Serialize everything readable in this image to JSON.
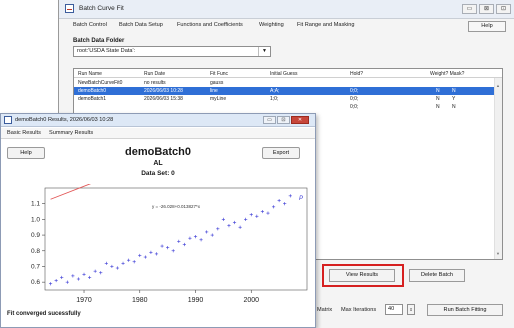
{
  "main_window": {
    "title": "Batch Curve Fit",
    "controls": [
      "▭",
      "⊠",
      "⊡"
    ],
    "tabs": [
      "Batch Control",
      "Batch Data Setup",
      "Functions and Coefficients",
      "Weighting",
      "Fit Range and Masking"
    ],
    "help_label": "Help",
    "folder_label": "Batch Data Folder",
    "folder_value": "root:'USDA State Data':",
    "folder_arrow": "▼"
  },
  "batch_table": {
    "headers": [
      "Run Name",
      "Run Date",
      "Fit Func",
      "Initial Guess",
      "Hold?",
      "Weight? Mask?"
    ],
    "rows": [
      {
        "run_name": "NewBatchCurveFit0",
        "run_date": "no results",
        "fit_func": "gauss",
        "initial_guess": "",
        "hold": "",
        "weight": "",
        "mask": "",
        "selected": false
      },
      {
        "run_name": "demoBatch0",
        "run_date": "2026/06/03 10:28",
        "fit_func": "line",
        "initial_guess": "A;A;",
        "hold": "0;0;",
        "weight": "N",
        "mask": "N",
        "selected": true
      },
      {
        "run_name": "demoBatch1",
        "run_date": "2026/06/03 15:38",
        "fit_func": "myLine",
        "initial_guess": "1;0;",
        "hold": "0;0;",
        "weight": "N",
        "mask": "Y",
        "selected": false
      },
      {
        "run_name": "",
        "run_date": "",
        "fit_func": "",
        "initial_guess": "",
        "hold": "0;0;",
        "weight": "N",
        "mask": "N",
        "selected": false
      }
    ]
  },
  "buttons": {
    "view_results": "View Results",
    "delete_batch": "Delete Batch",
    "run_batch_fitting": "Run Batch Fitting"
  },
  "bottom": {
    "matrix_label": "Matrix",
    "max_iterations_label": "Max Iterations",
    "max_iterations_value": "40",
    "spin_glyph": "⇕"
  },
  "results_window": {
    "title": "demoBatch0 Results, 2026/06/03 10:28",
    "controls": [
      "▭",
      "⊡",
      "✕"
    ],
    "tabs": [
      "Basic Results",
      "Summary Results"
    ],
    "help_label": "Help",
    "export_label": "Export",
    "batch_name": "demoBatch0",
    "state": "AL",
    "data_set": "Data Set: 0",
    "status": "Fit converged sucessfully"
  },
  "chart_data": {
    "type": "scatter",
    "title": "",
    "annotation": "y = -26.028+0.013827*x",
    "legend_marker": "P",
    "xlim": [
      1963,
      2010
    ],
    "ylim": [
      0.55,
      1.2
    ],
    "x_ticks": [
      1970,
      1980,
      1990,
      2000
    ],
    "y_ticks": [
      0.6,
      0.7,
      0.8,
      0.9,
      1.0,
      1.1
    ],
    "fit_line": {
      "slope": 0.013827,
      "intercept": -26.028,
      "color": "#e25555"
    },
    "point_color": "#3b3bd6",
    "points": [
      [
        1964,
        0.59
      ],
      [
        1965,
        0.61
      ],
      [
        1966,
        0.63
      ],
      [
        1967,
        0.6
      ],
      [
        1968,
        0.64
      ],
      [
        1969,
        0.62
      ],
      [
        1970,
        0.65
      ],
      [
        1971,
        0.63
      ],
      [
        1972,
        0.67
      ],
      [
        1973,
        0.66
      ],
      [
        1974,
        0.72
      ],
      [
        1975,
        0.7
      ],
      [
        1976,
        0.69
      ],
      [
        1977,
        0.72
      ],
      [
        1978,
        0.74
      ],
      [
        1979,
        0.73
      ],
      [
        1980,
        0.77
      ],
      [
        1981,
        0.76
      ],
      [
        1982,
        0.79
      ],
      [
        1983,
        0.78
      ],
      [
        1984,
        0.83
      ],
      [
        1985,
        0.82
      ],
      [
        1986,
        0.8
      ],
      [
        1987,
        0.86
      ],
      [
        1988,
        0.84
      ],
      [
        1989,
        0.88
      ],
      [
        1990,
        0.89
      ],
      [
        1991,
        0.87
      ],
      [
        1992,
        0.92
      ],
      [
        1993,
        0.9
      ],
      [
        1994,
        0.94
      ],
      [
        1995,
        1.0
      ],
      [
        1996,
        0.96
      ],
      [
        1997,
        0.98
      ],
      [
        1998,
        0.95
      ],
      [
        1999,
        1.0
      ],
      [
        2000,
        1.03
      ],
      [
        2001,
        1.02
      ],
      [
        2002,
        1.05
      ],
      [
        2003,
        1.04
      ],
      [
        2004,
        1.08
      ],
      [
        2005,
        1.12
      ],
      [
        2006,
        1.1
      ],
      [
        2007,
        1.15
      ]
    ]
  }
}
